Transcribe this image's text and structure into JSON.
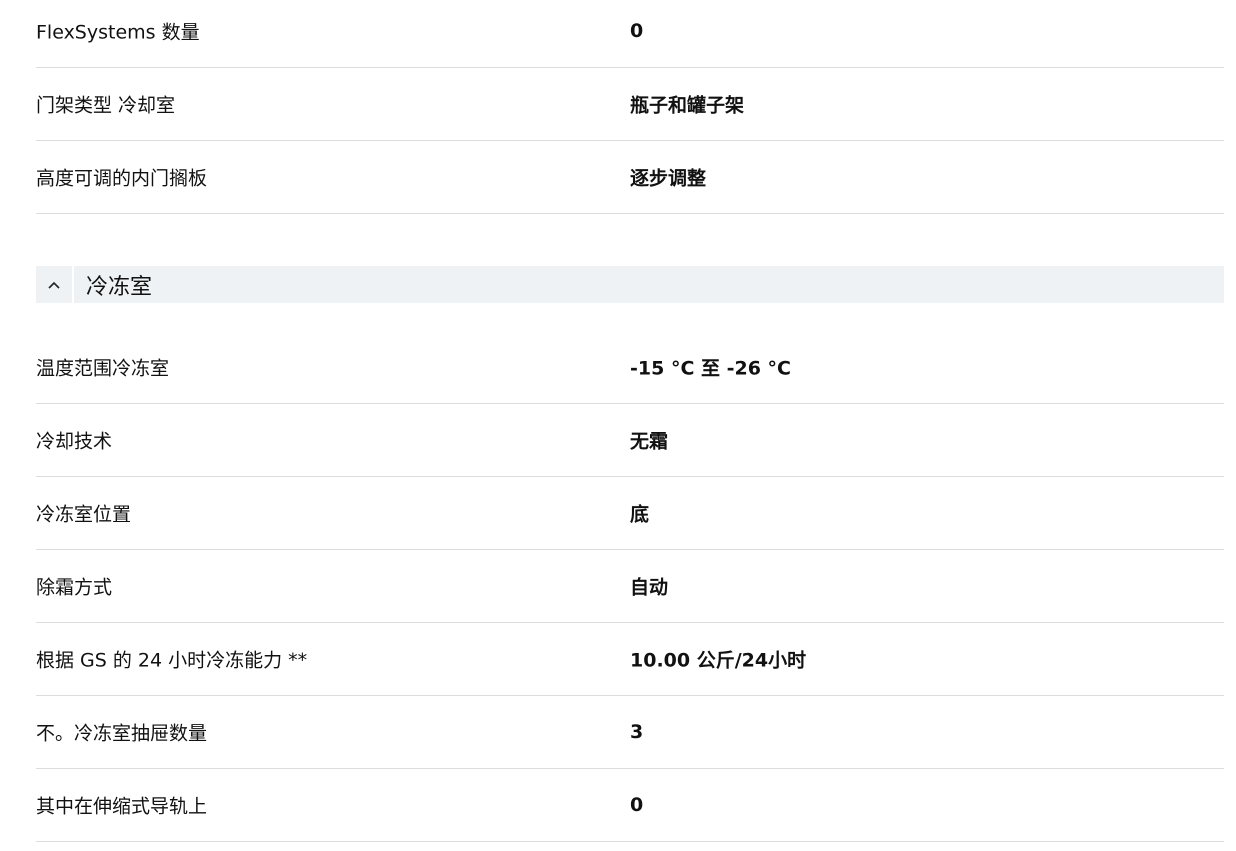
{
  "top_specs": [
    {
      "label": "FlexSystems 数量",
      "value": "0"
    },
    {
      "label": "门架类型 冷却室",
      "value": "瓶子和罐子架"
    },
    {
      "label": "高度可调的内门搁板",
      "value": "逐步调整"
    }
  ],
  "freezer_section": {
    "title": "冷冻室",
    "toggle_icon": "chevron-up-icon",
    "specs": [
      {
        "label": "温度范围冷冻室",
        "value": "-15 °C 至 -26 °C"
      },
      {
        "label": "冷却技术",
        "value": "无霜"
      },
      {
        "label": "冷冻室位置",
        "value": "底"
      },
      {
        "label": "除霜方式",
        "value": "自动"
      },
      {
        "label": "根据 GS 的 24 小时冷冻能力 **",
        "value": "10.00 公斤/24小时"
      },
      {
        "label": "不。冷冻室抽屉数量",
        "value": "3"
      },
      {
        "label": "其中在伸缩式导轨上",
        "value": "0"
      }
    ]
  }
}
